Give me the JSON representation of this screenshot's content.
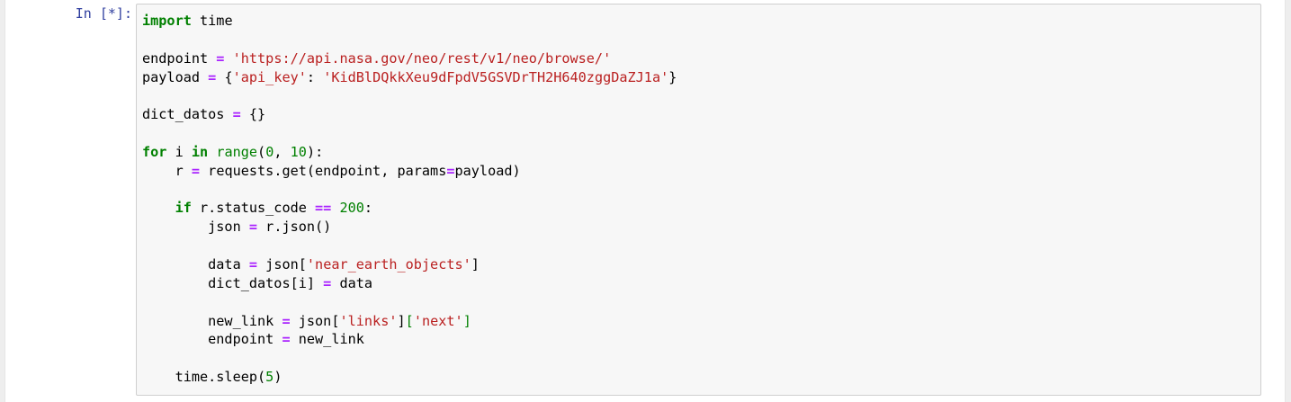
{
  "cell": {
    "prompt": "In [*]:",
    "colors": {
      "keyword": "#008000",
      "operator": "#aa22ff",
      "string": "#ba2121",
      "number": "#008000",
      "builtin": "#008000",
      "prompt": "#303f9f",
      "background": "#f7f7f7",
      "border": "#cfcfcf"
    },
    "lines": [
      [
        {
          "t": "import",
          "k": "kw"
        },
        {
          "t": " time",
          "k": "tx"
        }
      ],
      [],
      [
        {
          "t": "endpoint ",
          "k": "tx"
        },
        {
          "t": "=",
          "k": "op"
        },
        {
          "t": " ",
          "k": "tx"
        },
        {
          "t": "'https://api.nasa.gov/neo/rest/v1/neo/browse/'",
          "k": "st"
        }
      ],
      [
        {
          "t": "payload ",
          "k": "tx"
        },
        {
          "t": "=",
          "k": "op"
        },
        {
          "t": " {",
          "k": "tx"
        },
        {
          "t": "'api_key'",
          "k": "st"
        },
        {
          "t": ": ",
          "k": "tx"
        },
        {
          "t": "'KidBlDQkkXeu9dFpdV5GSVDrTH2H640zggDaZJ1a'",
          "k": "st"
        },
        {
          "t": "}",
          "k": "tx"
        }
      ],
      [],
      [
        {
          "t": "dict_datos ",
          "k": "tx"
        },
        {
          "t": "=",
          "k": "op"
        },
        {
          "t": " {}",
          "k": "tx"
        }
      ],
      [],
      [
        {
          "t": "for",
          "k": "kw"
        },
        {
          "t": " i ",
          "k": "tx"
        },
        {
          "t": "in",
          "k": "kw"
        },
        {
          "t": " ",
          "k": "tx"
        },
        {
          "t": "range",
          "k": "bi"
        },
        {
          "t": "(",
          "k": "tx"
        },
        {
          "t": "0",
          "k": "nu"
        },
        {
          "t": ", ",
          "k": "tx"
        },
        {
          "t": "10",
          "k": "nu"
        },
        {
          "t": "):",
          "k": "tx"
        }
      ],
      [
        {
          "t": "    r ",
          "k": "tx"
        },
        {
          "t": "=",
          "k": "op"
        },
        {
          "t": " requests.get(endpoint, params",
          "k": "tx"
        },
        {
          "t": "=",
          "k": "op"
        },
        {
          "t": "payload)",
          "k": "tx"
        }
      ],
      [],
      [
        {
          "t": "    ",
          "k": "tx"
        },
        {
          "t": "if",
          "k": "kw"
        },
        {
          "t": " r.status_code ",
          "k": "tx"
        },
        {
          "t": "==",
          "k": "op"
        },
        {
          "t": " ",
          "k": "tx"
        },
        {
          "t": "200",
          "k": "nu"
        },
        {
          "t": ":",
          "k": "tx"
        }
      ],
      [
        {
          "t": "        json ",
          "k": "tx"
        },
        {
          "t": "=",
          "k": "op"
        },
        {
          "t": " r.json()",
          "k": "tx"
        }
      ],
      [],
      [
        {
          "t": "        data ",
          "k": "tx"
        },
        {
          "t": "=",
          "k": "op"
        },
        {
          "t": " json[",
          "k": "tx"
        },
        {
          "t": "'near_earth_objects'",
          "k": "st"
        },
        {
          "t": "]",
          "k": "tx"
        }
      ],
      [
        {
          "t": "        dict_datos[i] ",
          "k": "tx"
        },
        {
          "t": "=",
          "k": "op"
        },
        {
          "t": " data",
          "k": "tx"
        }
      ],
      [],
      [
        {
          "t": "        new_link ",
          "k": "tx"
        },
        {
          "t": "=",
          "k": "op"
        },
        {
          "t": " json[",
          "k": "tx"
        },
        {
          "t": "'links'",
          "k": "st"
        },
        {
          "t": "]",
          "k": "tx"
        },
        {
          "t": "[",
          "k": "bkg"
        },
        {
          "t": "'next'",
          "k": "st"
        },
        {
          "t": "]",
          "k": "bkg"
        }
      ],
      [
        {
          "t": "        endpoint ",
          "k": "tx"
        },
        {
          "t": "=",
          "k": "op"
        },
        {
          "t": " new_link",
          "k": "tx"
        }
      ],
      [],
      [
        {
          "t": "    time.sleep(",
          "k": "tx"
        },
        {
          "t": "5",
          "k": "nu"
        },
        {
          "t": ")",
          "k": "tx"
        }
      ]
    ]
  }
}
